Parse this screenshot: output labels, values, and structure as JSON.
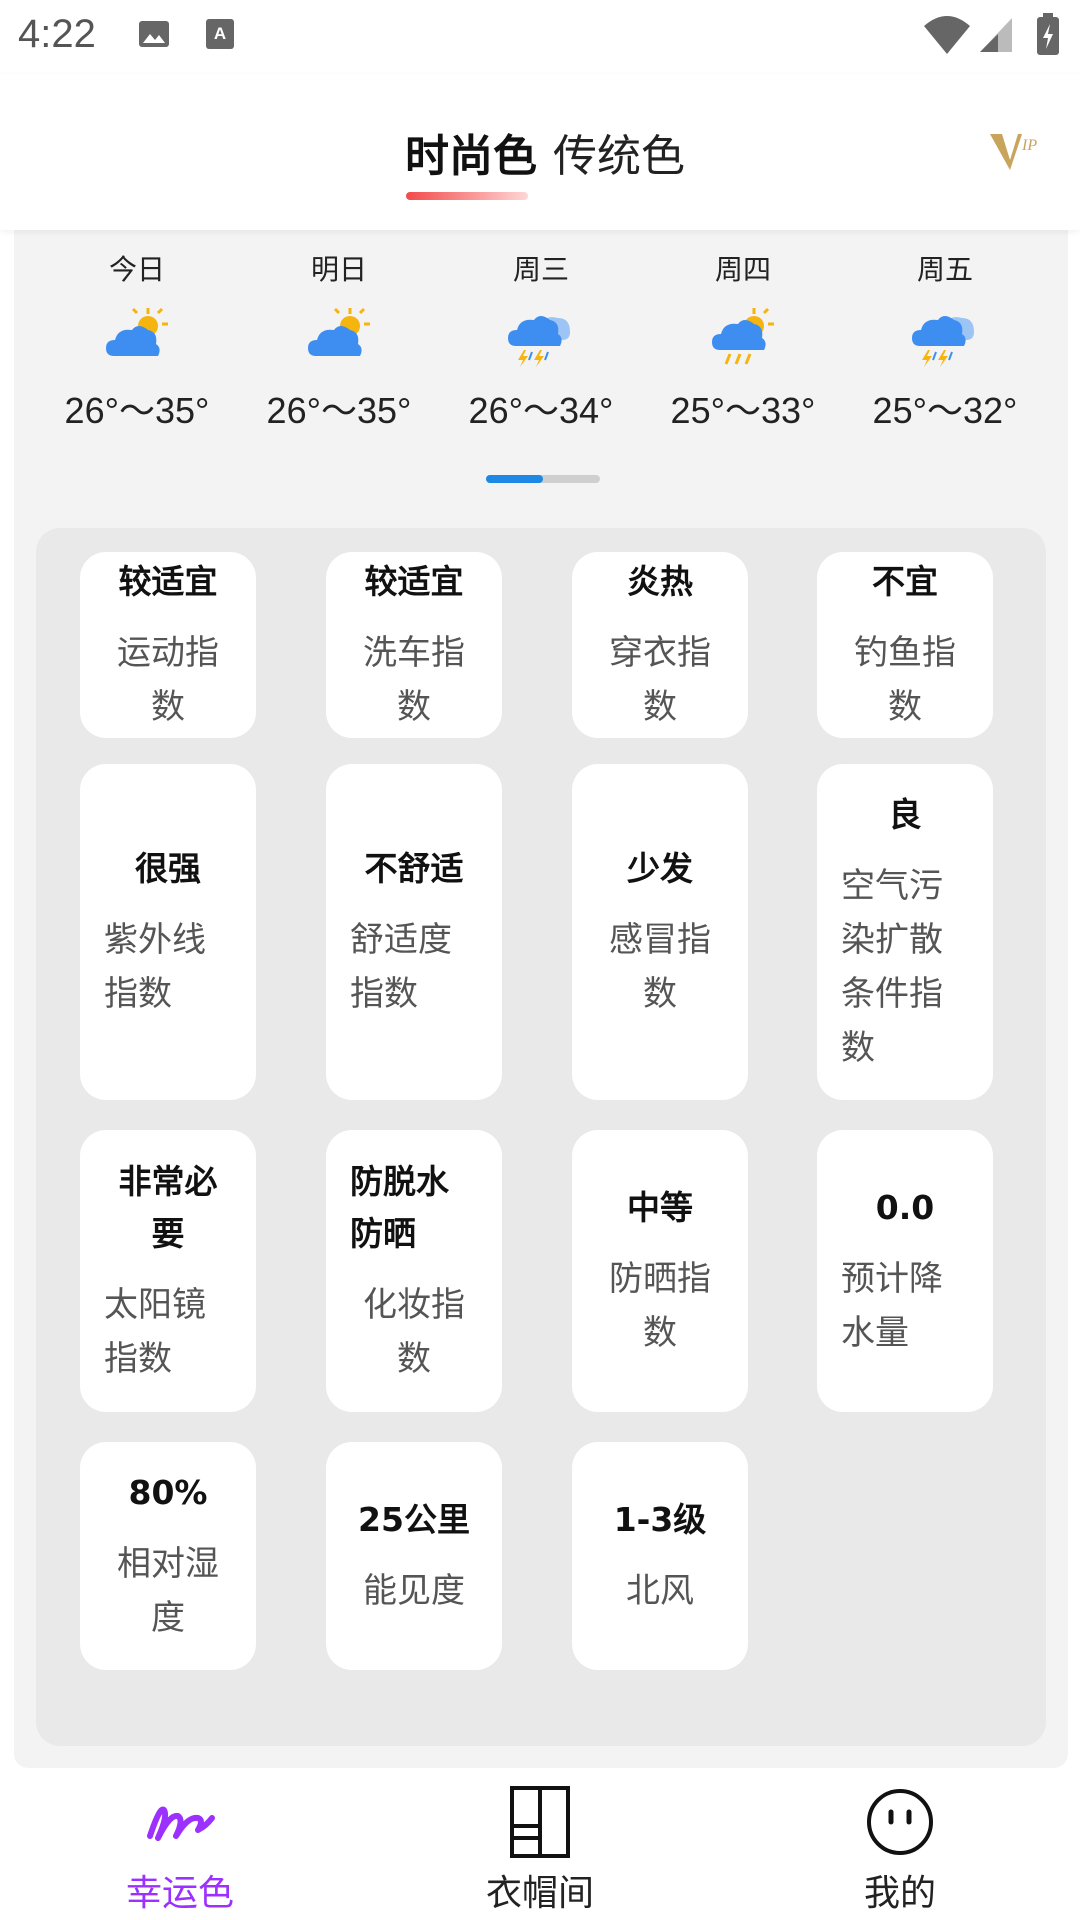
{
  "status_bar": {
    "time": "4:22"
  },
  "header": {
    "tabs": [
      {
        "label": "时尚色",
        "active": true
      },
      {
        "label": "传统色",
        "active": false
      }
    ],
    "vip_icon": "vip-icon"
  },
  "forecast": [
    {
      "day": "今日",
      "icon": "partly-cloudy-sun-icon",
      "temp": "26°～35°"
    },
    {
      "day": "明日",
      "icon": "partly-cloudy-sun-icon",
      "temp": "26°～35°"
    },
    {
      "day": "周三",
      "icon": "thunderstorm-icon",
      "temp": "26°～34°"
    },
    {
      "day": "周四",
      "icon": "sun-rain-icon",
      "temp": "25°～33°"
    },
    {
      "day": "周五",
      "icon": "thunderstorm-icon",
      "temp": "25°～32°"
    }
  ],
  "pager": {
    "current": 1,
    "total": 2
  },
  "indices": [
    {
      "value": "较适宜",
      "label": "运动指数"
    },
    {
      "value": "较适宜",
      "label": "洗车指数"
    },
    {
      "value": "炎热",
      "label": "穿衣指数"
    },
    {
      "value": "不宜",
      "label": "钓鱼指数"
    },
    {
      "value": "很强",
      "label": "紫外线指数"
    },
    {
      "value": "不舒适",
      "label": "舒适度指数"
    },
    {
      "value": "少发",
      "label": "感冒指数"
    },
    {
      "value": "良",
      "label": "空气污染扩散条件指数"
    },
    {
      "value": "非常必要",
      "label": "太阳镜指数"
    },
    {
      "value": "防脱水防晒",
      "label": "化妆指数"
    },
    {
      "value": "中等",
      "label": "防晒指数"
    },
    {
      "value": "0.0",
      "label": "预计降水量"
    },
    {
      "value": "80%",
      "label": "相对湿度"
    },
    {
      "value": "25公里",
      "label": "能见度"
    },
    {
      "value": "1-3级",
      "label": "北风"
    }
  ],
  "bottom_nav": [
    {
      "label": "幸运色",
      "icon": "lucky-color-icon",
      "active": true
    },
    {
      "label": "衣帽间",
      "icon": "wardrobe-icon",
      "active": false
    },
    {
      "label": "我的",
      "icon": "smiley-face-icon",
      "active": false
    }
  ],
  "colors": {
    "accent": "#9b30ff",
    "tab_underline": "#f24b4b",
    "pager": "#1e88e5",
    "panel_bg": "#f3f3f3"
  }
}
